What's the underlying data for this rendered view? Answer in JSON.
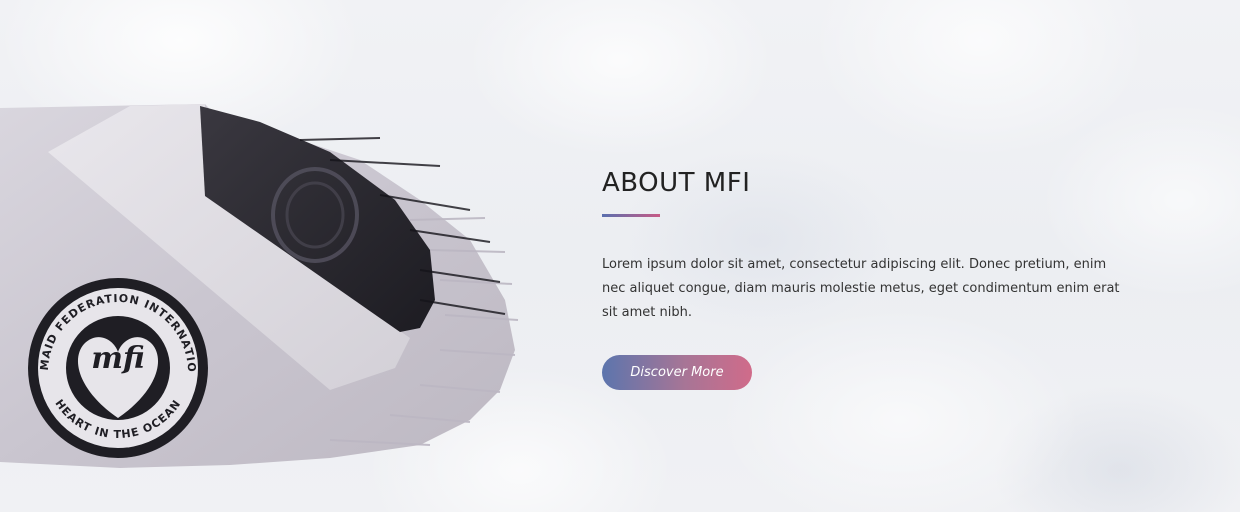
{
  "about": {
    "title": "ABOUT MFI",
    "body": "Lorem ipsum dolor sit amet, consectetur adipiscing elit. Donec pretium, enim nec aliquet congue, diam mauris molestie metus, eget condimentum enim erat sit amet nibh.",
    "button_label": "Discover More"
  },
  "image": {
    "seal_top_text": "MERMAID FEDERATION INTERNATIONAL",
    "seal_bottom_text": "HEART IN THE OCEAN",
    "seal_logo_text": "mfi"
  },
  "colors": {
    "accent_start": "#5c75ad",
    "accent_end": "#d06b8a",
    "title": "#222222",
    "body": "#333333"
  },
  "icons": [
    "mfi-seal-logo-icon",
    "stamp-block-icon"
  ]
}
